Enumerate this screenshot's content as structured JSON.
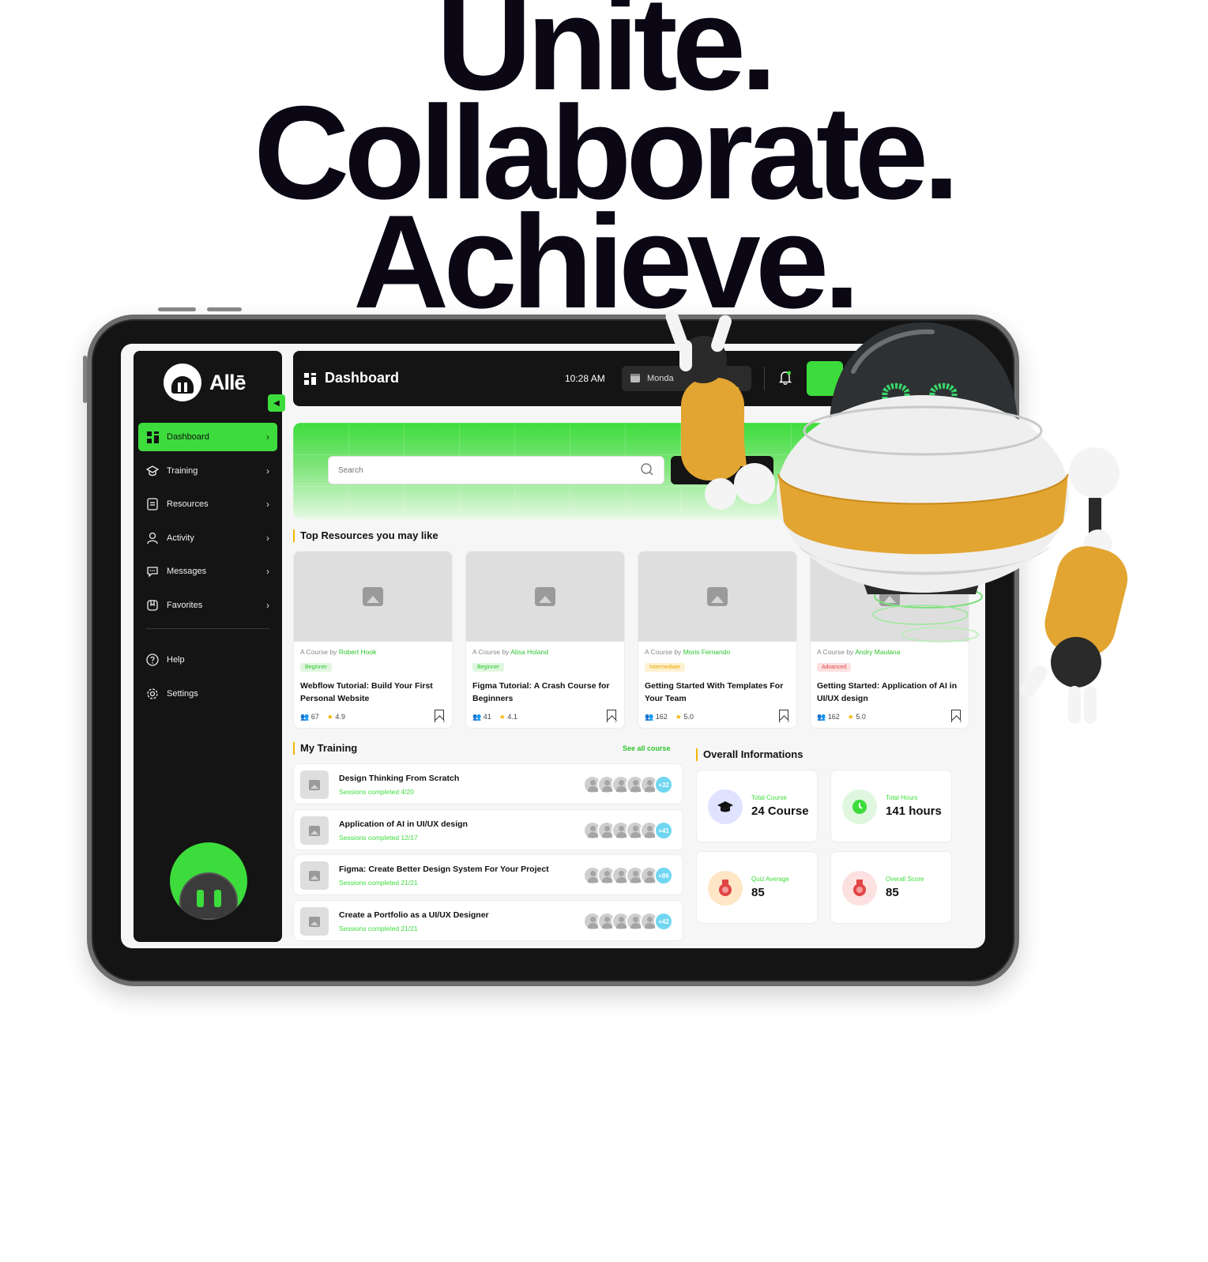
{
  "hero": {
    "line1": "Unite.",
    "line2": "Collaborate.",
    "line3": "Achieve."
  },
  "brand": {
    "name": "Allē",
    "accent": "#3ddc3d",
    "dark": "#141414"
  },
  "topbar": {
    "title": "Dashboard",
    "time": "10:28 AM",
    "date": "Monda",
    "icons": [
      "grid-icon",
      "calendar-icon",
      "bell-icon",
      "avatar-icon"
    ]
  },
  "sidebar": {
    "items": [
      {
        "label": "Dashboard",
        "icon": "grid-icon",
        "active": true
      },
      {
        "label": "Training",
        "icon": "graduation-cap-icon"
      },
      {
        "label": "Resources",
        "icon": "document-icon"
      },
      {
        "label": "Activity",
        "icon": "user-icon"
      },
      {
        "label": "Messages",
        "icon": "chat-icon"
      },
      {
        "label": "Favorites",
        "icon": "bookmark-icon"
      }
    ],
    "bottom": [
      {
        "label": "Help",
        "icon": "help-icon"
      },
      {
        "label": "Settings",
        "icon": "gear-icon"
      }
    ]
  },
  "search": {
    "placeholder": "Search"
  },
  "resources": {
    "title": "Top Resources you may like",
    "by_prefix": "A Course by",
    "courses": [
      {
        "author": "Robert Hook",
        "level": "Beginner",
        "title": "Webflow Tutorial: Build Your First Personal Website",
        "students": "67",
        "rating": "4.9"
      },
      {
        "author": "Alisa Holand",
        "level": "Beginner",
        "title": "Figma Tutorial: A Crash Course for Beginners",
        "students": "41",
        "rating": "4.1"
      },
      {
        "author": "Moris Fernando",
        "level": "Intermediate",
        "title": "Getting Started With Templates For Your Team",
        "students": "162",
        "rating": "5.0"
      },
      {
        "author": "Andry Maulana",
        "level": "Advanced",
        "title": "Getting Started: Application of AI in UI/UX design",
        "students": "162",
        "rating": "5.0"
      }
    ]
  },
  "training": {
    "title": "My Training",
    "see_all": "See all course",
    "items": [
      {
        "title": "Design Thinking From Scratch",
        "progress": "Sessions completed 4/20",
        "more": "+32"
      },
      {
        "title": "Application of AI in UI/UX design",
        "progress": "Sessions completed 12/17",
        "more": "+41"
      },
      {
        "title": "Figma: Create Better Design System For Your Project",
        "progress": "Sessions completed 21/21",
        "more": "+86"
      },
      {
        "title": "Create a Portfolio as a UI/UX Designer",
        "progress": "Sessions completed 21/21",
        "more": "+42"
      }
    ]
  },
  "overall": {
    "title": "Overall Informations",
    "cards": [
      {
        "label": "Total Course",
        "value": "24 Course",
        "icon": "graduation-cap-icon",
        "color": "#dfe3ff"
      },
      {
        "label": "Total Hours",
        "value": "141 hours",
        "icon": "clock-icon",
        "color": "#dff7df"
      },
      {
        "label": "Quiz Average",
        "value": "85",
        "icon": "medal-icon",
        "color": "#ffe6c7"
      },
      {
        "label": "Overall Score",
        "value": "85",
        "icon": "medal-icon",
        "color": "#fde0e0"
      }
    ]
  }
}
